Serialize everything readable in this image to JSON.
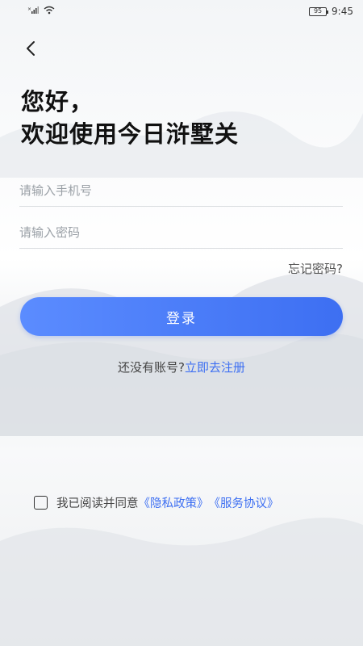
{
  "status_bar": {
    "time": "9:45",
    "battery": "95",
    "icons": [
      "no-sim-icon",
      "signal-icon",
      "wifi-icon",
      "battery-icon"
    ]
  },
  "header": {
    "back_icon": "chevron-left-icon",
    "greeting_line1": "您好，",
    "greeting_line2": "欢迎使用今日浒墅关"
  },
  "form": {
    "phone_placeholder": "请输入手机号",
    "phone_value": "",
    "password_placeholder": "请输入密码",
    "password_value": "",
    "forgot_label": "忘记密码?",
    "login_label": "登录"
  },
  "register": {
    "prompt": "还没有账号?",
    "link": "立即去注册"
  },
  "agreement": {
    "checked": false,
    "text": "我已阅读并同意",
    "privacy_link": "《隐私政策》",
    "service_link": "《服务协议》"
  },
  "colors": {
    "accent": "#3d6ff2",
    "accent_light": "#5b8cff",
    "text_primary": "#111111",
    "placeholder": "#9aa0a6"
  }
}
